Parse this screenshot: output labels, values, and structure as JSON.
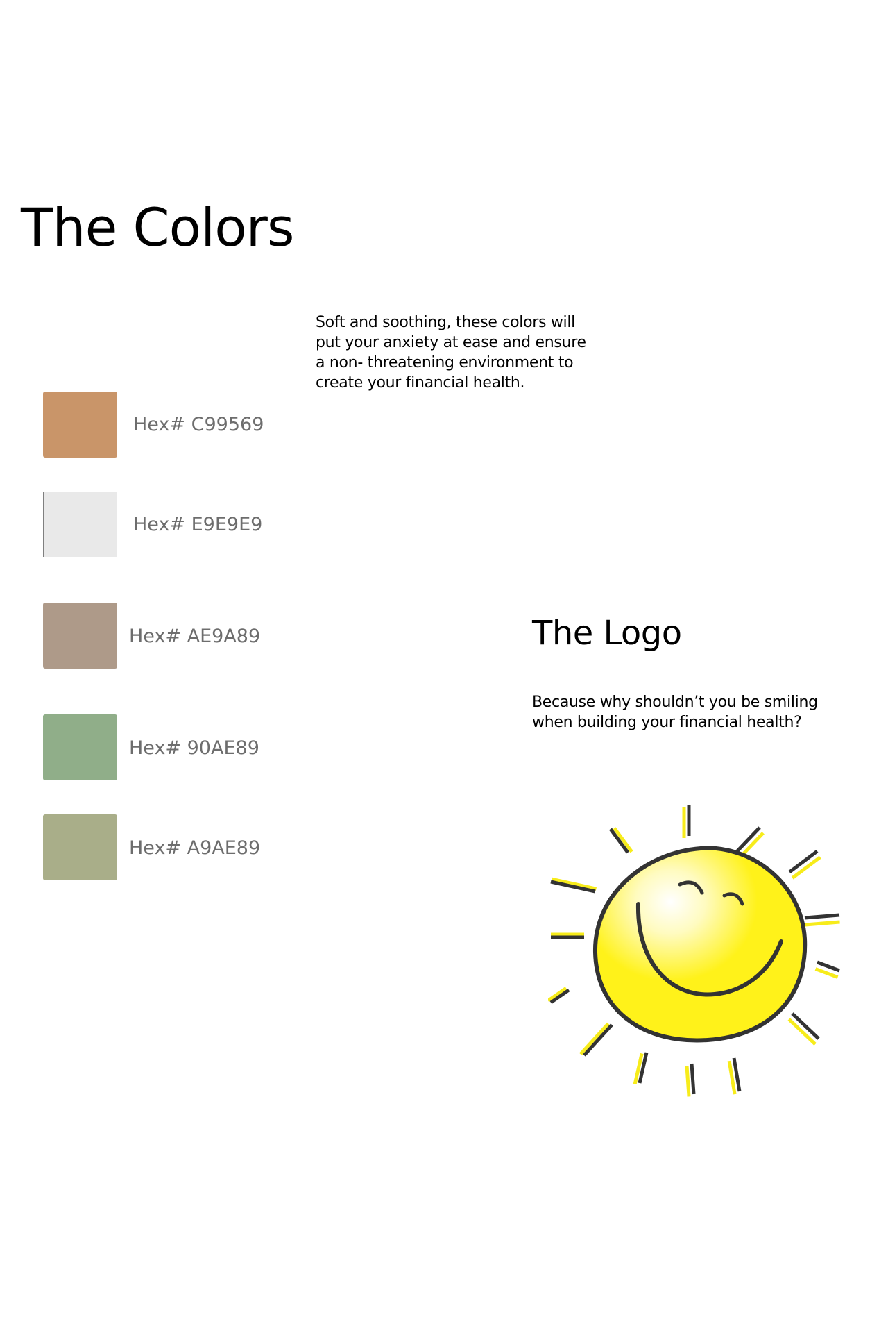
{
  "colors_section": {
    "title": "The Colors",
    "description": "Soft and soothing, these colors will put your anxiety at ease and ensure a non- threatening environment to create your financial health.",
    "swatches": [
      {
        "color": "#C99569",
        "label": "Hex# C99569"
      },
      {
        "color": "#E9E9E9",
        "label": "Hex# E9E9E9"
      },
      {
        "color": "#AE9A89",
        "label": "Hex# AE9A89"
      },
      {
        "color": "#90AE89",
        "label": "Hex# 90AE89"
      },
      {
        "color": "#A9AE89",
        "label": "Hex# A9AE89"
      }
    ]
  },
  "logo_section": {
    "title": "The Logo",
    "description": "Because why shouldn’t you be smiling when building your financial health?",
    "logo_icon": "smiling-sun-icon",
    "logo_colors": {
      "face": "#FFF21A",
      "outline": "#333333",
      "ray_highlight": "#F7EC1B"
    }
  }
}
